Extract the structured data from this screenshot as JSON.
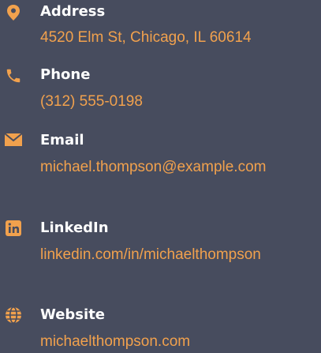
{
  "colors": {
    "background": "#474c5e",
    "accent": "#f1a14d",
    "label": "#ffffff"
  },
  "contacts": [
    {
      "icon": "map-pin-icon",
      "label": "Address",
      "value": "4520 Elm St, Chicago, IL 60614"
    },
    {
      "icon": "phone-icon",
      "label": "Phone",
      "value": "(312) 555-0198"
    },
    {
      "icon": "envelope-icon",
      "label": "Email",
      "value": "michael.thompson@example.com"
    },
    {
      "icon": "linkedin-icon",
      "label": "LinkedIn",
      "value": "linkedin.com/in/michaelthompson"
    },
    {
      "icon": "globe-icon",
      "label": "Website",
      "value": "michaelthompson.com"
    }
  ]
}
